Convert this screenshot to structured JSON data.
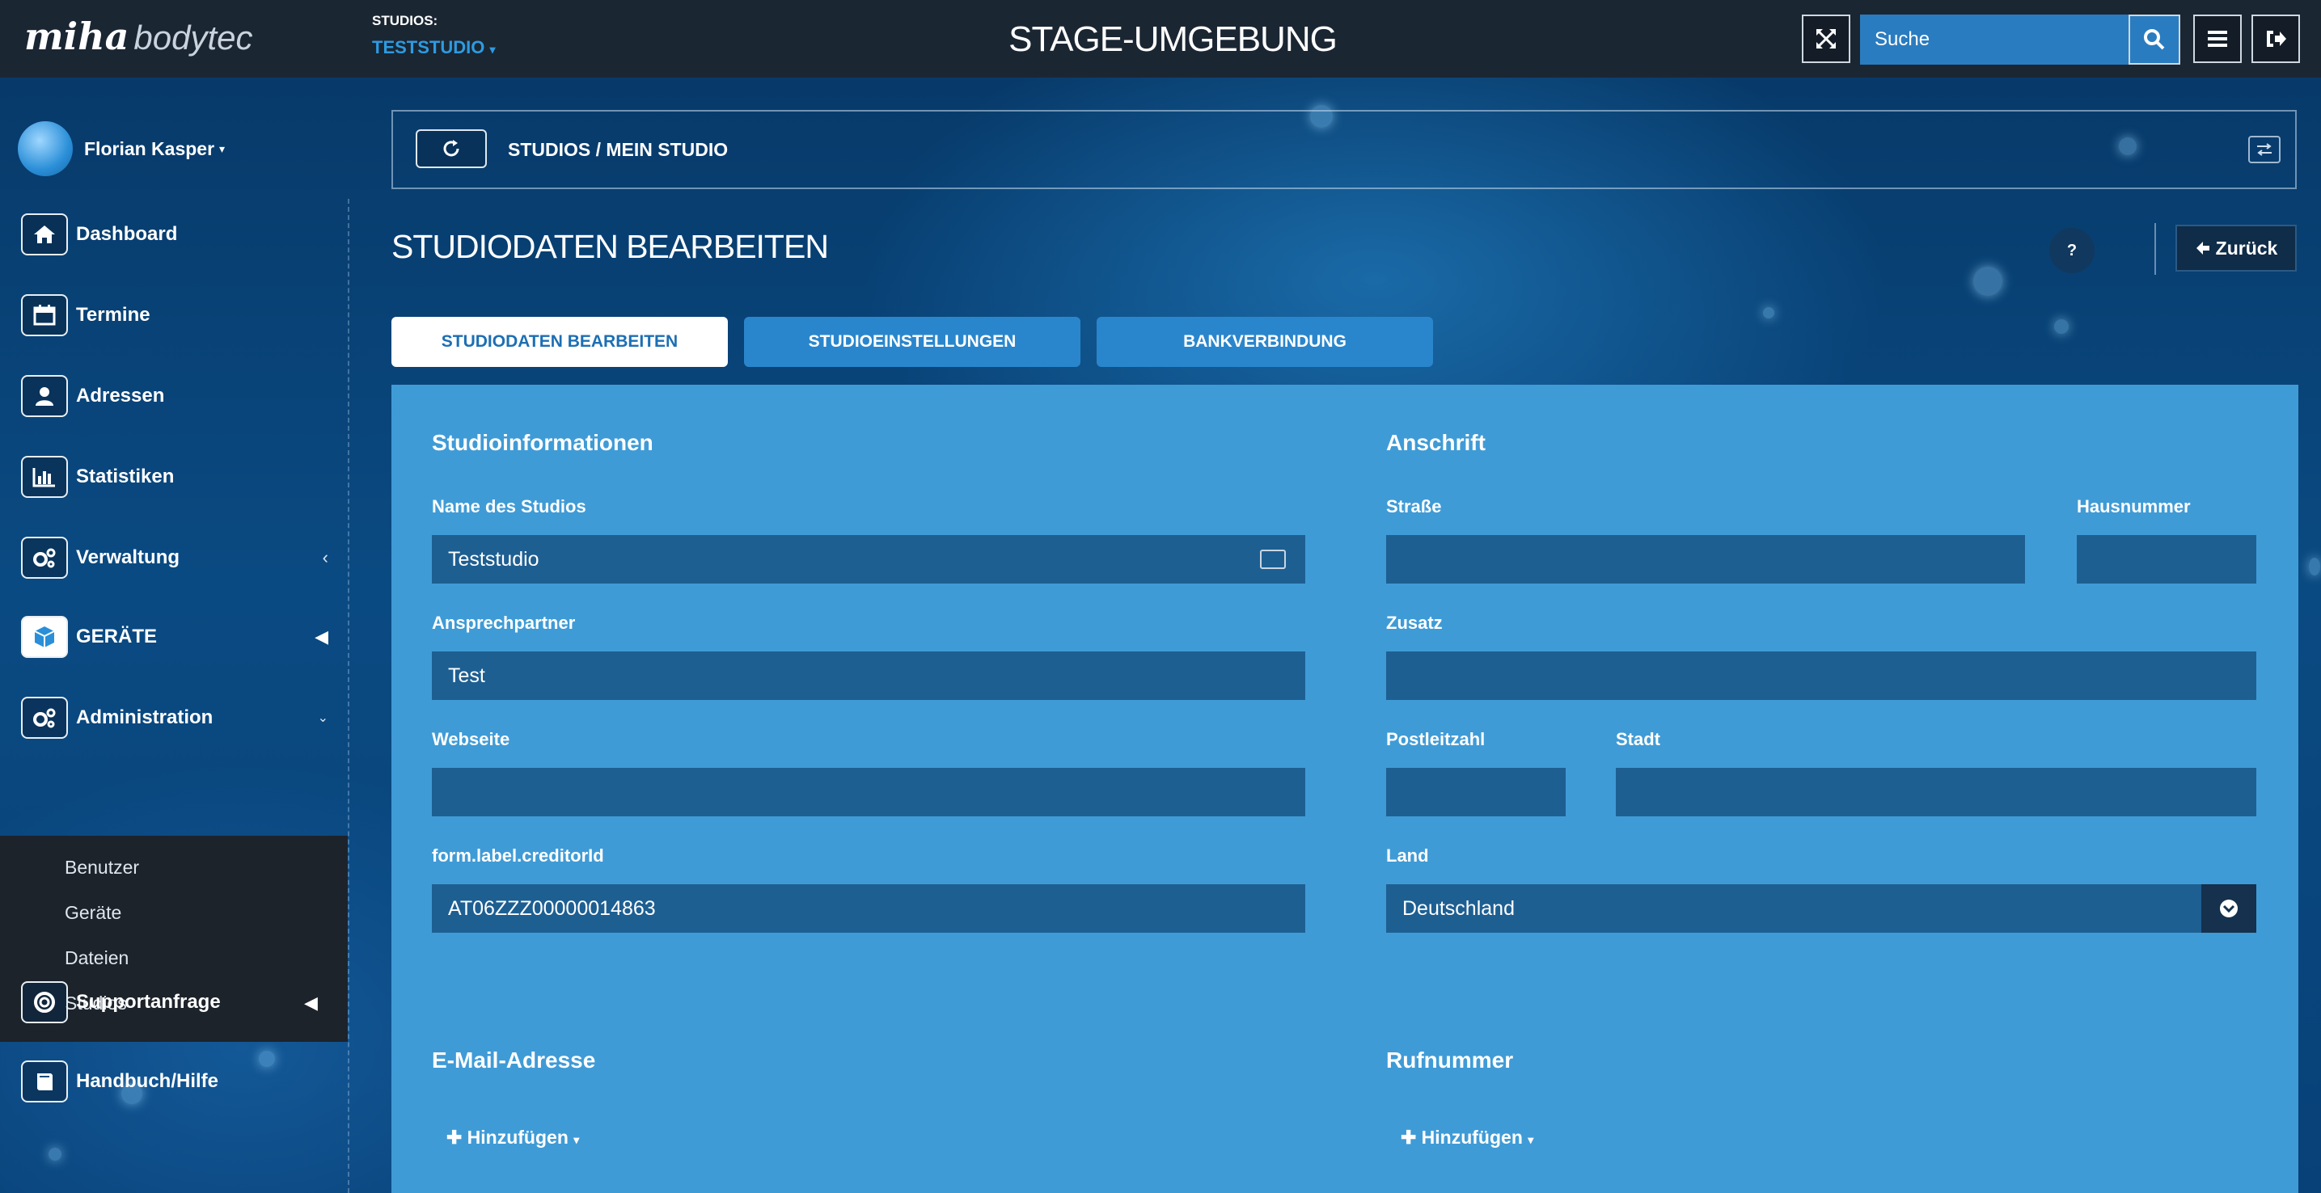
{
  "topbar": {
    "logo_primary": "miha",
    "logo_secondary": "bodytec",
    "studio_label": "STUDIOS:",
    "studio_value": "TESTSTUDIO",
    "environment_title": "STAGE-UMGEBUNG",
    "search_placeholder": "Suche"
  },
  "sidebar": {
    "user_name": "Florian Kasper",
    "items": [
      {
        "label": "Dashboard",
        "icon": "home-icon"
      },
      {
        "label": "Termine",
        "icon": "calendar-icon"
      },
      {
        "label": "Adressen",
        "icon": "user-icon"
      },
      {
        "label": "Statistiken",
        "icon": "bar-chart-icon"
      },
      {
        "label": "Verwaltung",
        "icon": "cogs-icon"
      },
      {
        "label": "GERÄTE",
        "icon": "cube-icon"
      },
      {
        "label": "Administration",
        "icon": "cogs-icon"
      }
    ],
    "submenu": [
      "Benutzer",
      "Geräte",
      "Dateien",
      "Studios"
    ],
    "bottom_items": [
      {
        "label": "Supportanfrage",
        "icon": "lifebuoy-icon"
      },
      {
        "label": "Handbuch/Hilfe",
        "icon": "book-icon"
      }
    ]
  },
  "main": {
    "breadcrumb": "STUDIOS / MEIN STUDIO",
    "page_title": "STUDIODATEN BEARBEITEN",
    "help_label": "?",
    "back_label": "Zurück",
    "tabs": [
      {
        "label": "STUDIODATEN BEARBEITEN",
        "active": true
      },
      {
        "label": "STUDIOEINSTELLUNGEN",
        "active": false
      },
      {
        "label": "BANKVERBINDUNG",
        "active": false
      }
    ]
  },
  "form": {
    "left_section_title": "Studioinformationen",
    "right_section_title": "Anschrift",
    "fields": {
      "studio_name": {
        "label": "Name des Studios",
        "value": "Teststudio"
      },
      "contact": {
        "label": "Ansprechpartner",
        "value": "Test"
      },
      "website": {
        "label": "Webseite",
        "value": ""
      },
      "creditor": {
        "label": "form.label.creditorId",
        "value": "AT06ZZZ00000014863"
      },
      "street": {
        "label": "Straße",
        "value": ""
      },
      "house_number": {
        "label": "Hausnummer",
        "value": ""
      },
      "extra": {
        "label": "Zusatz",
        "value": ""
      },
      "zip": {
        "label": "Postleitzahl",
        "value": ""
      },
      "city": {
        "label": "Stadt",
        "value": ""
      },
      "country": {
        "label": "Land",
        "value": "Deutschland"
      }
    },
    "email_title": "E-Mail-Adresse",
    "phone_title": "Rufnummer",
    "add_label": "Hinzufügen"
  },
  "colors": {
    "topbar": "#1b2633",
    "panel": "#3f9bd6",
    "field": "#1e5f92",
    "accent": "#2d9be0"
  }
}
